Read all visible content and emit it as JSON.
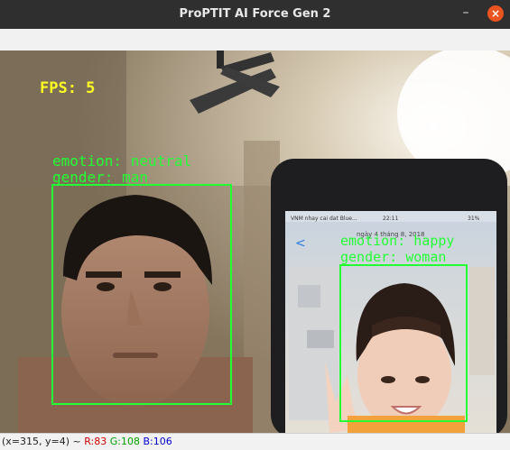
{
  "window": {
    "title": "ProPTIT AI Force Gen 2",
    "minimize_symbol": "–",
    "close_symbol": "×"
  },
  "overlay": {
    "fps_label": "FPS: 5",
    "face1": {
      "emotion": "emotion: neutral",
      "gender": "gender: man"
    },
    "face2": {
      "emotion": "emotion: happy",
      "gender": "gender: woman"
    }
  },
  "phone": {
    "status_left": "VNM nhay cai dat Blue...",
    "status_time": "22:11",
    "status_right": "31%",
    "header_date": "ngày 4 tháng 8, 2018",
    "back_symbol": "<"
  },
  "status": {
    "coords": "(x=315, y=4) ~",
    "r": "R:83",
    "g": "G:108",
    "b": "B:106"
  },
  "colors": {
    "overlay_green": "#22ff33",
    "fps_yellow": "#ffff22",
    "r_color": "#d00000",
    "g_color": "#00a000",
    "b_color": "#0000d0"
  }
}
